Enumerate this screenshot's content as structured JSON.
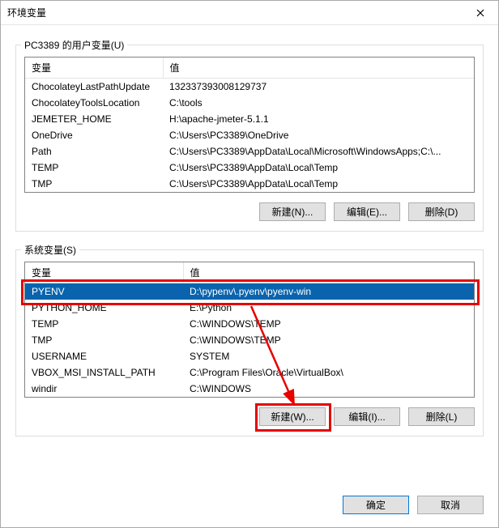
{
  "window": {
    "title": "环境变量"
  },
  "user_group": {
    "label": "PC3389 的用户变量(U)",
    "header_name": "变量",
    "header_value": "值",
    "rows": [
      {
        "name": "ChocolateyLastPathUpdate",
        "value": "132337393008129737"
      },
      {
        "name": "ChocolateyToolsLocation",
        "value": "C:\\tools"
      },
      {
        "name": "JEMETER_HOME",
        "value": "H:\\apache-jmeter-5.1.1"
      },
      {
        "name": "OneDrive",
        "value": "C:\\Users\\PC3389\\OneDrive"
      },
      {
        "name": "Path",
        "value": "C:\\Users\\PC3389\\AppData\\Local\\Microsoft\\WindowsApps;C:\\..."
      },
      {
        "name": "TEMP",
        "value": "C:\\Users\\PC3389\\AppData\\Local\\Temp"
      },
      {
        "name": "TMP",
        "value": "C:\\Users\\PC3389\\AppData\\Local\\Temp"
      }
    ],
    "buttons": {
      "new": "新建(N)...",
      "edit": "编辑(E)...",
      "delete": "删除(D)"
    }
  },
  "sys_group": {
    "label": "系统变量(S)",
    "header_name": "变量",
    "header_value": "值",
    "rows": [
      {
        "name": "PYENV",
        "value": "D:\\pypenv\\.pyenv\\pyenv-win",
        "selected": true
      },
      {
        "name": "PYTHON_HOME",
        "value": "E:\\Python"
      },
      {
        "name": "TEMP",
        "value": "C:\\WINDOWS\\TEMP"
      },
      {
        "name": "TMP",
        "value": "C:\\WINDOWS\\TEMP"
      },
      {
        "name": "USERNAME",
        "value": "SYSTEM"
      },
      {
        "name": "VBOX_MSI_INSTALL_PATH",
        "value": "C:\\Program Files\\Oracle\\VirtualBox\\"
      },
      {
        "name": "windir",
        "value": "C:\\WINDOWS"
      }
    ],
    "buttons": {
      "new": "新建(W)...",
      "edit": "编辑(I)...",
      "delete": "删除(L)"
    }
  },
  "footer": {
    "ok": "确定",
    "cancel": "取消"
  },
  "annotation_color": "#e60000"
}
